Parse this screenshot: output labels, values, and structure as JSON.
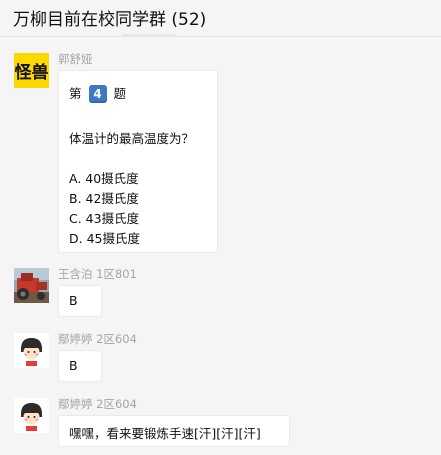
{
  "header": {
    "title": "万柳目前在校同学群 (52)"
  },
  "messages": [
    {
      "sender": "郭舒娅",
      "avatar_icon": "monster-sticker-icon",
      "avatar_text": "怪兽",
      "quiz": {
        "prefix": "第",
        "number": "4",
        "suffix": "题",
        "question": "体温计的最高温度为？",
        "options": [
          "A. 40摄氏度",
          "B. 42摄氏度",
          "C. 43摄氏度",
          "D. 45摄氏度"
        ]
      }
    },
    {
      "sender": "王含泊 1区801",
      "avatar_icon": "tractor-photo-icon",
      "text": "B"
    },
    {
      "sender": "鄢婷婷 2区604",
      "avatar_icon": "cartoon-girl-icon",
      "text": "B"
    },
    {
      "sender": "鄢婷婷 2区604",
      "avatar_icon": "cartoon-girl-icon",
      "text": "嘿嘿，看来要锻炼手速[汗][汗][汗]"
    }
  ],
  "colors": {
    "background": "#f5f5f5",
    "bubble": "#ffffff",
    "sender_name": "#a4a4a4",
    "badge_blue": "#3d78c2",
    "avatar_yellow": "#ffd800"
  }
}
